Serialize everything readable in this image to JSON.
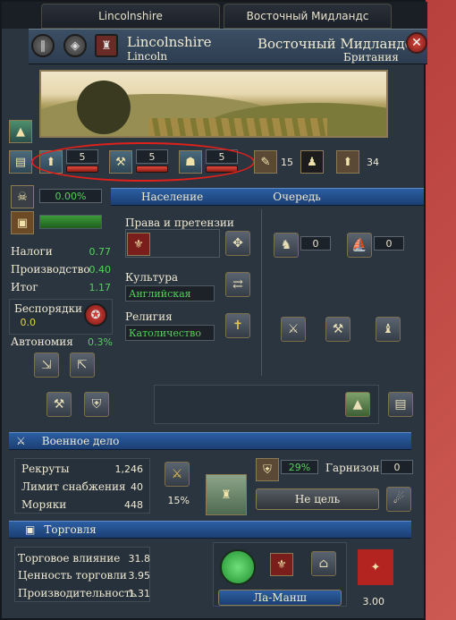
{
  "tabs": {
    "left": "Lincolnshire",
    "right": "Восточный Мидландс"
  },
  "header": {
    "province": "Lincolnshire",
    "capital": "Lincoln",
    "area": "Восточный Мидландс",
    "region": "Британия"
  },
  "dev": {
    "tax": "5",
    "production": "5",
    "manpower": "5",
    "devastation": "15",
    "total": "34"
  },
  "icons": [
    "book-icon",
    "tax-dev-icon",
    "production-dev-icon",
    "manpower-dev-icon",
    "devastation-icon",
    "keyhole-icon",
    "total-dev-icon"
  ],
  "left": {
    "percent": "0.00%",
    "taxes_label": "Налоги",
    "taxes": "0.77",
    "production_label": "Производство",
    "production": "0.40",
    "total_label": "Итог",
    "total": "1.17",
    "unrest_label": "Беспорядки",
    "unrest": "0.0",
    "autonomy_label": "Автономия",
    "autonomy": "0.3%"
  },
  "tabs2": {
    "population": "Население",
    "queue": "Очередь"
  },
  "claims": {
    "label": "Права и претензии",
    "culture_label": "Культура",
    "culture": "Английская",
    "religion_label": "Религия",
    "religion": "Католичество"
  },
  "queue": {
    "units": "0",
    "ships": "0"
  },
  "military": {
    "title": "Военное дело",
    "manpower_label": "Рекруты",
    "manpower": "1,246",
    "supply_label": "Лимит снабжения",
    "supply": "40",
    "sailors_label": "Моряки",
    "sailors": "448",
    "morale": "15%",
    "fort": "29%",
    "garrison_label": "Гарнизон:",
    "garrison": "0",
    "target": "Не цель"
  },
  "trade": {
    "title": "Торговля",
    "power_label": "Торговое влияние",
    "power": "31.8",
    "value_label": "Ценность торговли",
    "value": "3.95",
    "prod_label": "Производительность",
    "prod": "1.31",
    "node": "Ла-Манш",
    "goods": "3.00"
  },
  "colors": {
    "accent": "#2a5ea3",
    "positive": "#53d15a",
    "alert": "#e0201a"
  }
}
